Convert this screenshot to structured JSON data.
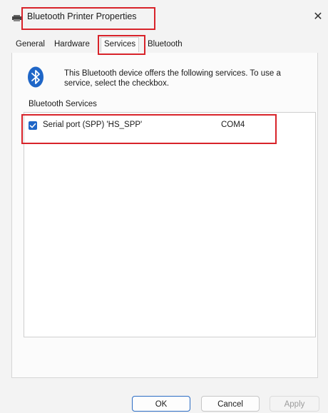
{
  "window": {
    "title": "Bluetooth Printer Properties",
    "close_glyph": "✕",
    "app_icon": "printer-icon",
    "close_icon": "close-icon"
  },
  "tabs": [
    {
      "label": "General"
    },
    {
      "label": "Hardware"
    },
    {
      "label": "Services",
      "selected": true
    },
    {
      "label": "Bluetooth"
    }
  ],
  "services_page": {
    "icon": "bluetooth-icon",
    "description": "This Bluetooth device offers the following services. To use a service, select the checkbox.",
    "group_label": "Bluetooth Services",
    "services": [
      {
        "name": "Serial port (SPP) 'HS_SPP'",
        "port": "COM4",
        "checked": true
      }
    ]
  },
  "buttons": {
    "ok": "OK",
    "cancel": "Cancel",
    "apply": "Apply"
  },
  "colors": {
    "accent": "#1f66c7",
    "highlight": "#d8232a"
  }
}
